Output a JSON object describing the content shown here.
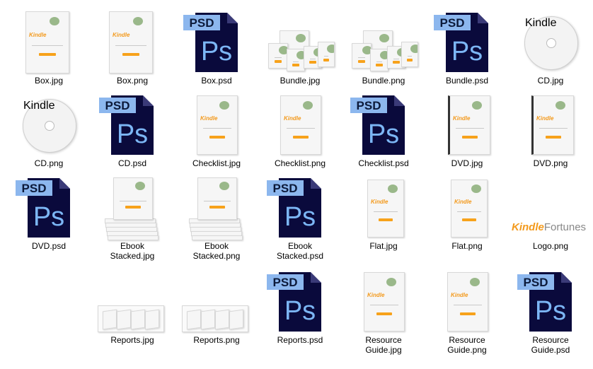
{
  "files": [
    {
      "label": "Box.jpg",
      "kind": "box"
    },
    {
      "label": "Box.png",
      "kind": "box"
    },
    {
      "label": "Box.psd",
      "kind": "psd",
      "badge": "PSD",
      "mark": "Ps"
    },
    {
      "label": "Bundle.jpg",
      "kind": "bundle"
    },
    {
      "label": "Bundle.png",
      "kind": "bundle"
    },
    {
      "label": "Bundle.psd",
      "kind": "psd",
      "badge": "PSD",
      "mark": "Ps"
    },
    {
      "label": "CD.jpg",
      "kind": "cd"
    },
    {
      "label": "CD.png",
      "kind": "cd"
    },
    {
      "label": "CD.psd",
      "kind": "psd",
      "badge": "PSD",
      "mark": "Ps"
    },
    {
      "label": "Checklist.jpg",
      "kind": "book"
    },
    {
      "label": "Checklist.png",
      "kind": "book"
    },
    {
      "label": "Checklist.psd",
      "kind": "psd",
      "badge": "PSD",
      "mark": "Ps"
    },
    {
      "label": "DVD.jpg",
      "kind": "dvd"
    },
    {
      "label": "DVD.png",
      "kind": "dvd"
    },
    {
      "label": "DVD.psd",
      "kind": "psd",
      "badge": "PSD",
      "mark": "Ps"
    },
    {
      "label": "Ebook\nStacked.jpg",
      "kind": "stack"
    },
    {
      "label": "Ebook\nStacked.png",
      "kind": "stack"
    },
    {
      "label": "Ebook\nStacked.psd",
      "kind": "psd",
      "badge": "PSD",
      "mark": "Ps"
    },
    {
      "label": "Flat.jpg",
      "kind": "flat"
    },
    {
      "label": "Flat.png",
      "kind": "flat"
    },
    {
      "label": "Logo.png",
      "kind": "logo"
    },
    {
      "label": "Reports.jpg",
      "kind": "reports"
    },
    {
      "label": "Reports.png",
      "kind": "reports"
    },
    {
      "label": "Reports.psd",
      "kind": "psd",
      "badge": "PSD",
      "mark": "Ps"
    },
    {
      "label": "Resource\nGuide.jpg",
      "kind": "book"
    },
    {
      "label": "Resource\nGuide.png",
      "kind": "book"
    },
    {
      "label": "Resource\nGuide.psd",
      "kind": "psd",
      "badge": "PSD",
      "mark": "Ps"
    }
  ],
  "mockup": {
    "brand_main": "Kindle",
    "brand_sub": "Fortunes"
  },
  "colors": {
    "psd_badge": "#8cb7ee",
    "psd_badge_text": "#0c1a3a",
    "psd_body": "#0a0a3c",
    "psd_mark": "#7cb6f5",
    "accent": "#f39a1d",
    "background": "#ffffff"
  },
  "icon_names": {
    "psd": "photoshop-psd-file-icon",
    "box": "box-mockup-thumbnail",
    "bundle": "bundle-mockup-thumbnail",
    "cd": "cd-mockup-thumbnail",
    "book": "book-mockup-thumbnail",
    "dvd": "dvd-case-mockup-thumbnail",
    "stack": "stacked-ebooks-thumbnail",
    "flat": "flat-cover-thumbnail",
    "logo": "logo-thumbnail",
    "reports": "reports-mockup-thumbnail"
  }
}
